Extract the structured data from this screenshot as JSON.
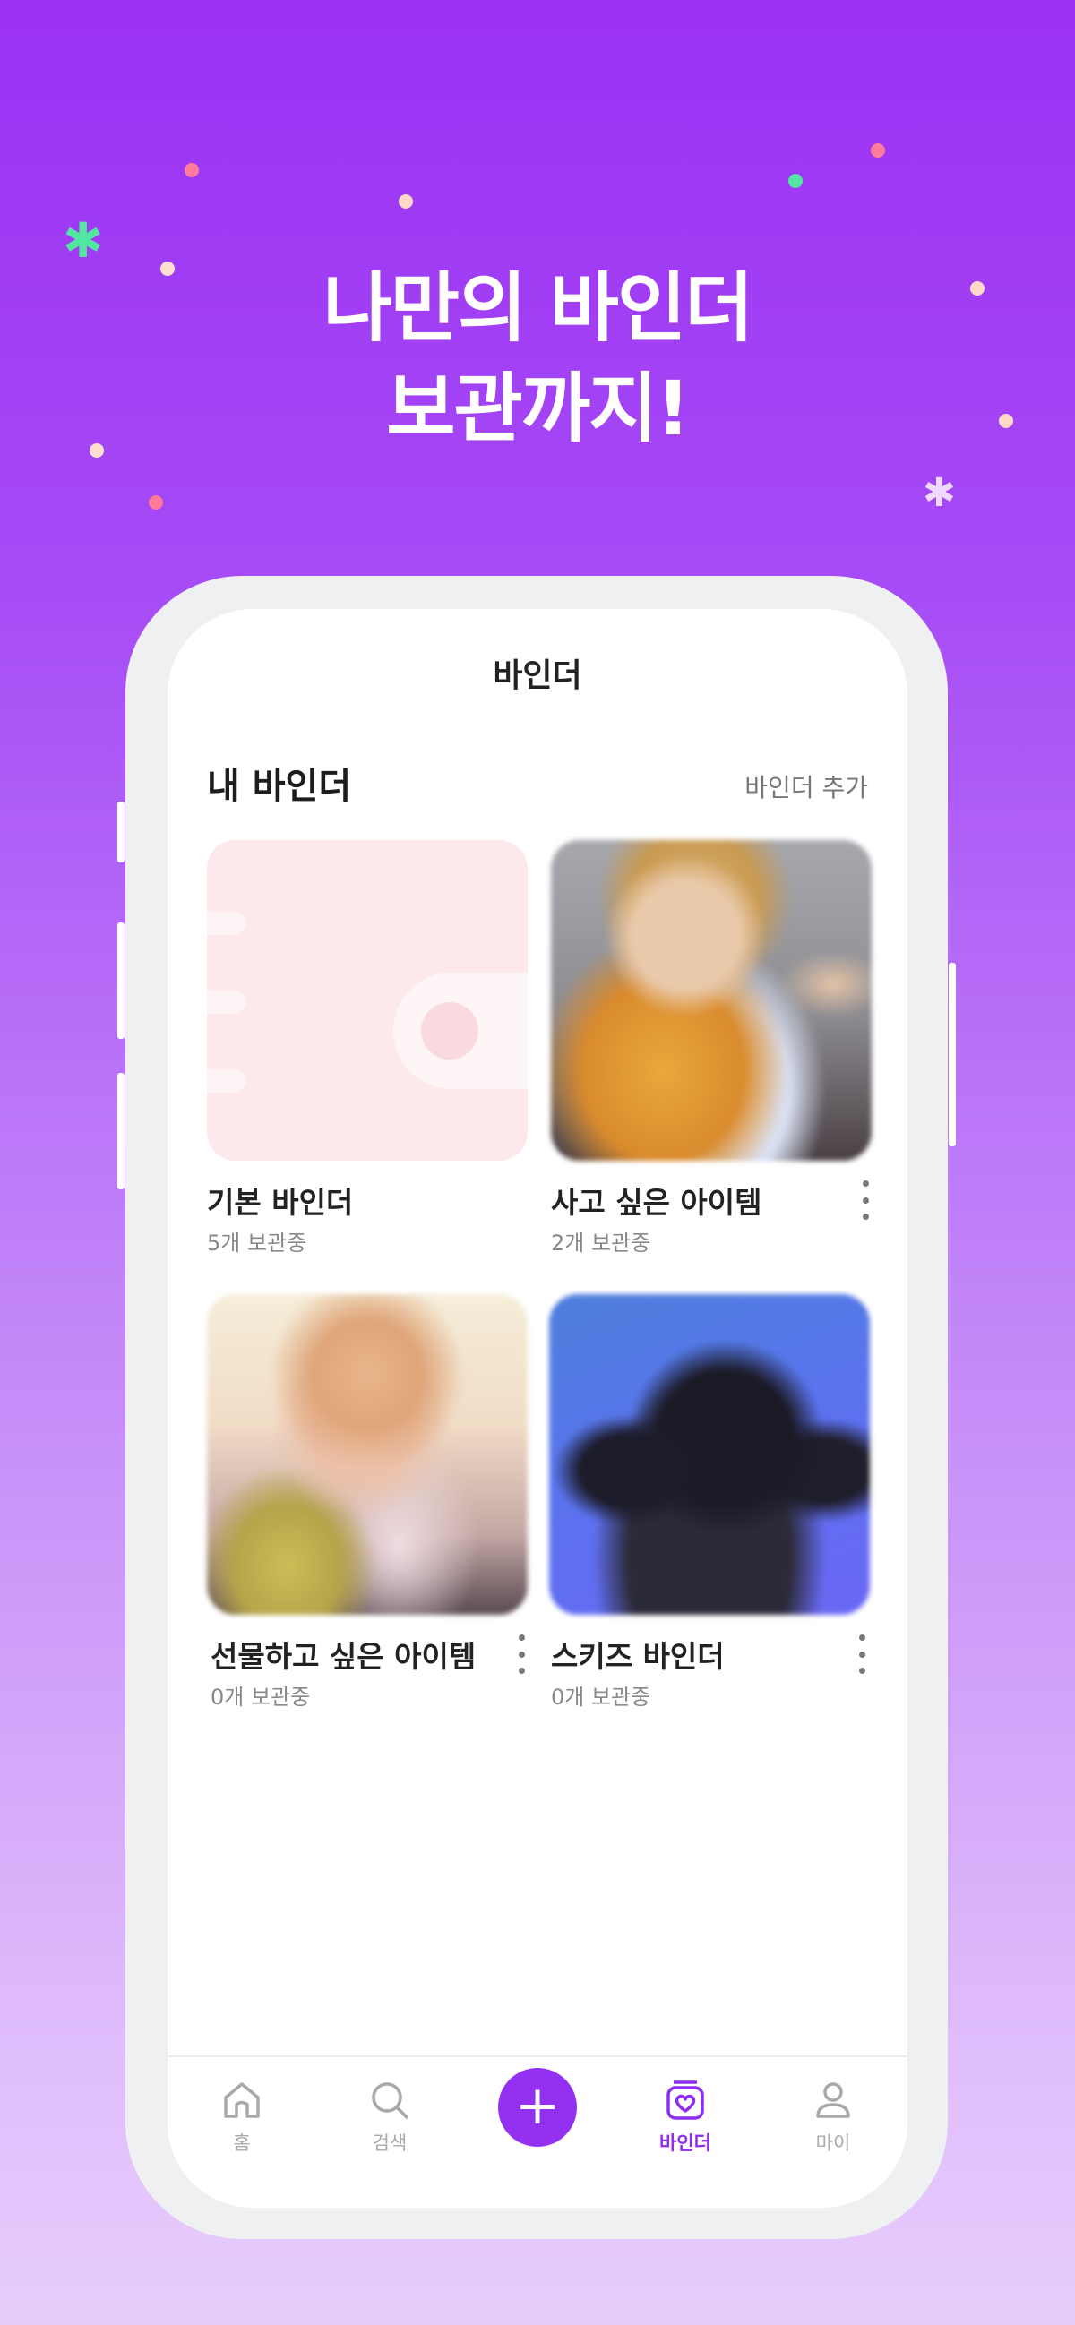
{
  "promo": {
    "headline_line1": "나만의 바인더",
    "headline_line2": "보관까지!"
  },
  "colors": {
    "accent": "#9431f0",
    "background_top": "#9b30f3",
    "background_bottom": "#e8cdfc"
  },
  "screen": {
    "title": "바인더",
    "section_title": "내 바인더",
    "add_binder_link": "바인더 추가"
  },
  "binders": [
    {
      "name": "기본 바인더",
      "count": "5개 보관중",
      "thumbnail": "wallet-illustration",
      "has_menu": false
    },
    {
      "name": "사고 싶은 아이템",
      "count": "2개 보관중",
      "thumbnail": "blurred-photo",
      "has_menu": true
    },
    {
      "name": "선물하고 싶은 아이템",
      "count": "0개 보관중",
      "thumbnail": "blurred-photo",
      "has_menu": true
    },
    {
      "name": "스키즈 바인더",
      "count": "0개 보관중",
      "thumbnail": "blurred-photo",
      "has_menu": true
    }
  ],
  "tabbar": {
    "items": [
      {
        "label": "홈",
        "icon": "home-icon",
        "active": false
      },
      {
        "label": "검색",
        "icon": "search-icon",
        "active": false
      },
      {
        "label": "",
        "icon": "plus-icon",
        "active": false
      },
      {
        "label": "바인더",
        "icon": "binder-heart-icon",
        "active": true
      },
      {
        "label": "마이",
        "icon": "user-icon",
        "active": false
      }
    ]
  }
}
